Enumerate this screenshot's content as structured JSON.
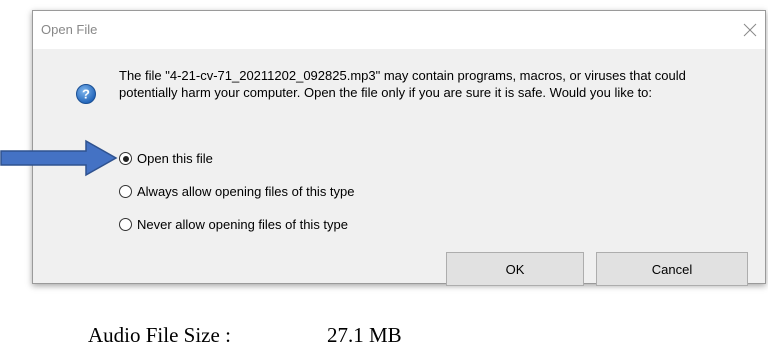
{
  "dialog": {
    "title": "Open File",
    "close_icon": "close-icon",
    "info_icon": "question-shield-icon",
    "message": "The file \"4-21-cv-71_20211202_092825.mp3\" may contain programs, macros, or viruses that could potentially harm your computer. Open the file only if you are sure it is safe. Would you like to:",
    "options": [
      {
        "label": "Open this file",
        "checked": true
      },
      {
        "label": "Always allow opening files of this type",
        "checked": false
      },
      {
        "label": "Never allow opening files of this type",
        "checked": false
      }
    ],
    "ok_label": "OK",
    "cancel_label": "Cancel"
  },
  "annotation": {
    "arrow_icon": "right-arrow-icon",
    "arrow_color": "#4472c4"
  },
  "background": {
    "label": "Audio File Size :",
    "value": "27.1 MB"
  }
}
